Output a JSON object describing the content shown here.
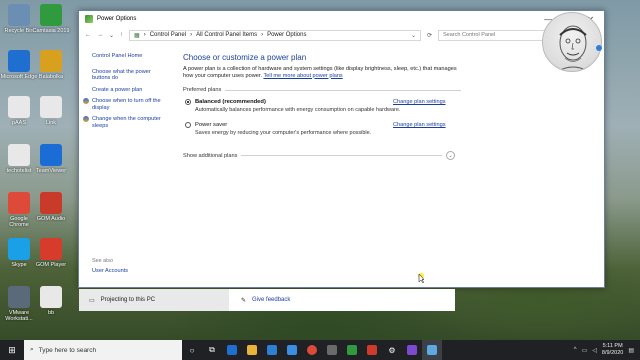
{
  "desktop": {
    "icons": [
      {
        "label": "Recycle Bin",
        "icon": "recycle-bin-icon",
        "color": "#6b8fb3"
      },
      {
        "label": "Camtasia 2019",
        "icon": "camtasia-icon",
        "color": "#2f9a3e"
      },
      {
        "label": "Microsoft Edge",
        "icon": "edge-icon",
        "color": "#1f6fd0"
      },
      {
        "label": "Balabolka",
        "icon": "balabolka-icon",
        "color": "#d8a01f"
      },
      {
        "label": "pAAS",
        "icon": "file-icon",
        "color": "#e8e8e8"
      },
      {
        "label": "Link",
        "icon": "file-icon",
        "color": "#e8e8e8"
      },
      {
        "label": "techotelist",
        "icon": "file-icon",
        "color": "#e8e8e8"
      },
      {
        "label": "TeamViewer",
        "icon": "teamviewer-icon",
        "color": "#1c6cd6"
      },
      {
        "label": "Google Chrome",
        "icon": "chrome-icon",
        "color": "#dd4a3a"
      },
      {
        "label": "GOM Audio",
        "icon": "gom-audio-icon",
        "color": "#c93a2a"
      },
      {
        "label": "Skype",
        "icon": "skype-icon",
        "color": "#1aa0e6"
      },
      {
        "label": "GOM Player",
        "icon": "gom-player-icon",
        "color": "#d63b2b"
      },
      {
        "label": "VMware Workstati...",
        "icon": "vmware-icon",
        "color": "#5a6a7a"
      },
      {
        "label": "bb",
        "icon": "file-icon",
        "color": "#e8e8e8"
      }
    ]
  },
  "window": {
    "title": "Power Options",
    "controls": {
      "minimize": "—",
      "maximize": "☐",
      "close": "✕"
    },
    "address": {
      "nav_back": "←",
      "nav_forward": "→",
      "nav_recent": "⌄",
      "nav_up": "↑",
      "crumbs": [
        "Control Panel",
        "All Control Panel Items",
        "Power Options"
      ],
      "separator": "›",
      "dropdown": "⌄",
      "refresh": "⟳",
      "search_placeholder": "Search Control Panel",
      "search_icon": "⌕"
    }
  },
  "leftnav": {
    "home": "Control Panel Home",
    "items": [
      "Choose what the power buttons do",
      "Create a power plan",
      "Choose when to turn off the display",
      "Change when the computer sleeps"
    ],
    "see_also_header": "See also",
    "see_also": [
      "User Accounts"
    ]
  },
  "main": {
    "title": "Choose or customize a power plan",
    "intro": "A power plan is a collection of hardware and system settings (like display brightness, sleep, etc.) that manages how your computer uses power.",
    "intro_link": "Tell me more about power plans",
    "preferred_header": "Preferred plans",
    "plans": [
      {
        "name": "Balanced (recommended)",
        "desc": "Automatically balances performance with energy consumption on capable hardware.",
        "selected": true,
        "change": "Change plan settings"
      },
      {
        "name": "Power saver",
        "desc": "Saves energy by reducing your computer's performance where possible.",
        "selected": false,
        "change": "Change plan settings"
      }
    ],
    "additional": "Show additional plans",
    "additional_chevron": "⌄"
  },
  "notification": {
    "left_text": "Projecting to this PC",
    "right_text": "Give feedback"
  },
  "taskbar": {
    "start_glyph": "⊞",
    "search_placeholder": "Type here to search",
    "clock_time": "5:11 PM",
    "clock_date": "8/9/2020",
    "tray_chevron": "^"
  }
}
